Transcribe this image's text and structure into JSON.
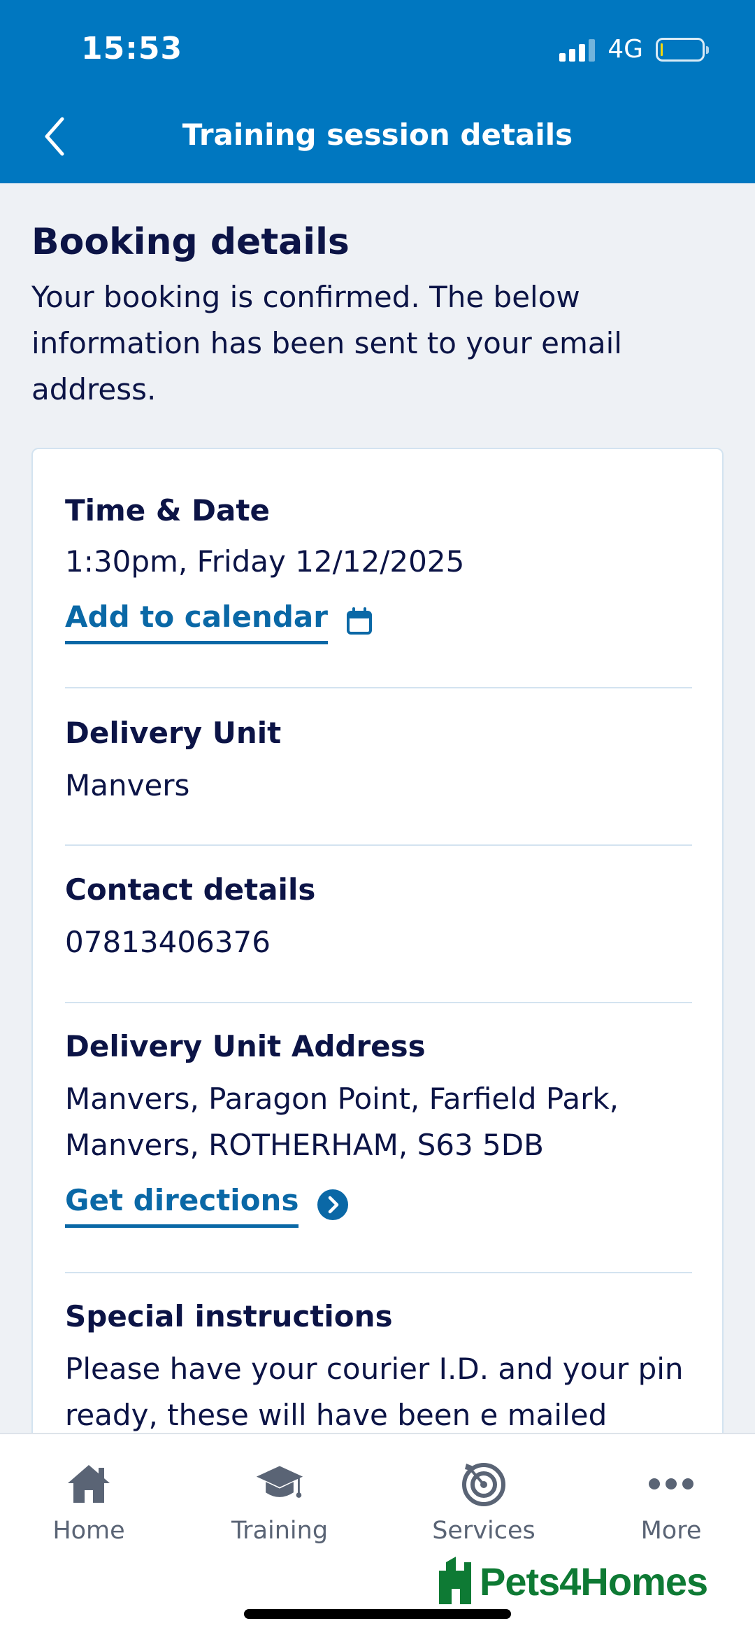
{
  "status_bar": {
    "time": "15:53",
    "network": "4G"
  },
  "header": {
    "title": "Training session details"
  },
  "booking": {
    "title": "Booking details",
    "intro": "Your booking is confirmed. The below information has been sent to your email address."
  },
  "details": {
    "time_date": {
      "label": "Time & Date",
      "value": "1:30pm, Friday 12/12/2025",
      "action": "Add to calendar"
    },
    "delivery_unit": {
      "label": "Delivery Unit",
      "value": "Manvers"
    },
    "contact": {
      "label": "Contact details",
      "value": "07813406376"
    },
    "address": {
      "label": "Delivery Unit Address",
      "value": "Manvers, Paragon Point, Farfield Park, Manvers, ROTHERHAM, S63 5DB",
      "action": "Get directions"
    },
    "special": {
      "label": "Special instructions",
      "value": "Please have your courier I.D. and your pin ready, these will have been e mailed"
    }
  },
  "nav": [
    {
      "label": "Home",
      "icon": "home-icon"
    },
    {
      "label": "Training",
      "icon": "graduation-cap-icon"
    },
    {
      "label": "Services",
      "icon": "target-icon"
    },
    {
      "label": "More",
      "icon": "more-dots-icon"
    }
  ],
  "watermark": {
    "text": "Pets4Homes"
  },
  "colors": {
    "header": "#0077c0",
    "link": "#0a68a6",
    "text": "#0c1446",
    "brand": "#0e7a34"
  }
}
